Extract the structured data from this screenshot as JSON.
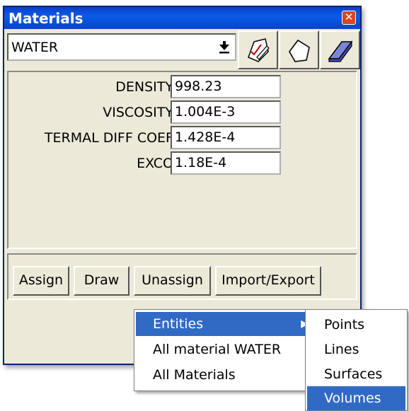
{
  "window": {
    "title": "Materials"
  },
  "material": {
    "selected": "WATER"
  },
  "toolbar": {
    "buttons": [
      "edit-material-icon",
      "new-material-icon",
      "erase-material-icon"
    ]
  },
  "properties": [
    {
      "label": "DENSITY",
      "value": "998.23"
    },
    {
      "label": "VISCOSITY",
      "value": "1.004E-3"
    },
    {
      "label": "TERMAL DIFF COEF",
      "value": "1.428E-4"
    },
    {
      "label": "EXCO",
      "value": "1.18E-4"
    }
  ],
  "actions": {
    "assign": "Assign",
    "draw": "Draw",
    "unassign": "Unassign",
    "import_export": "Import/Export"
  },
  "unassign_menu": {
    "items": [
      "Entities",
      "All material WATER",
      "All Materials"
    ],
    "highlighted": "Entities"
  },
  "entities_submenu": {
    "items": [
      "Points",
      "Lines",
      "Surfaces",
      "Volumes"
    ],
    "highlighted": "Volumes"
  },
  "colors": {
    "titlebar": "#0b5ae6",
    "menu_highlight": "#316ac5",
    "window_bg": "#ece9d8"
  }
}
